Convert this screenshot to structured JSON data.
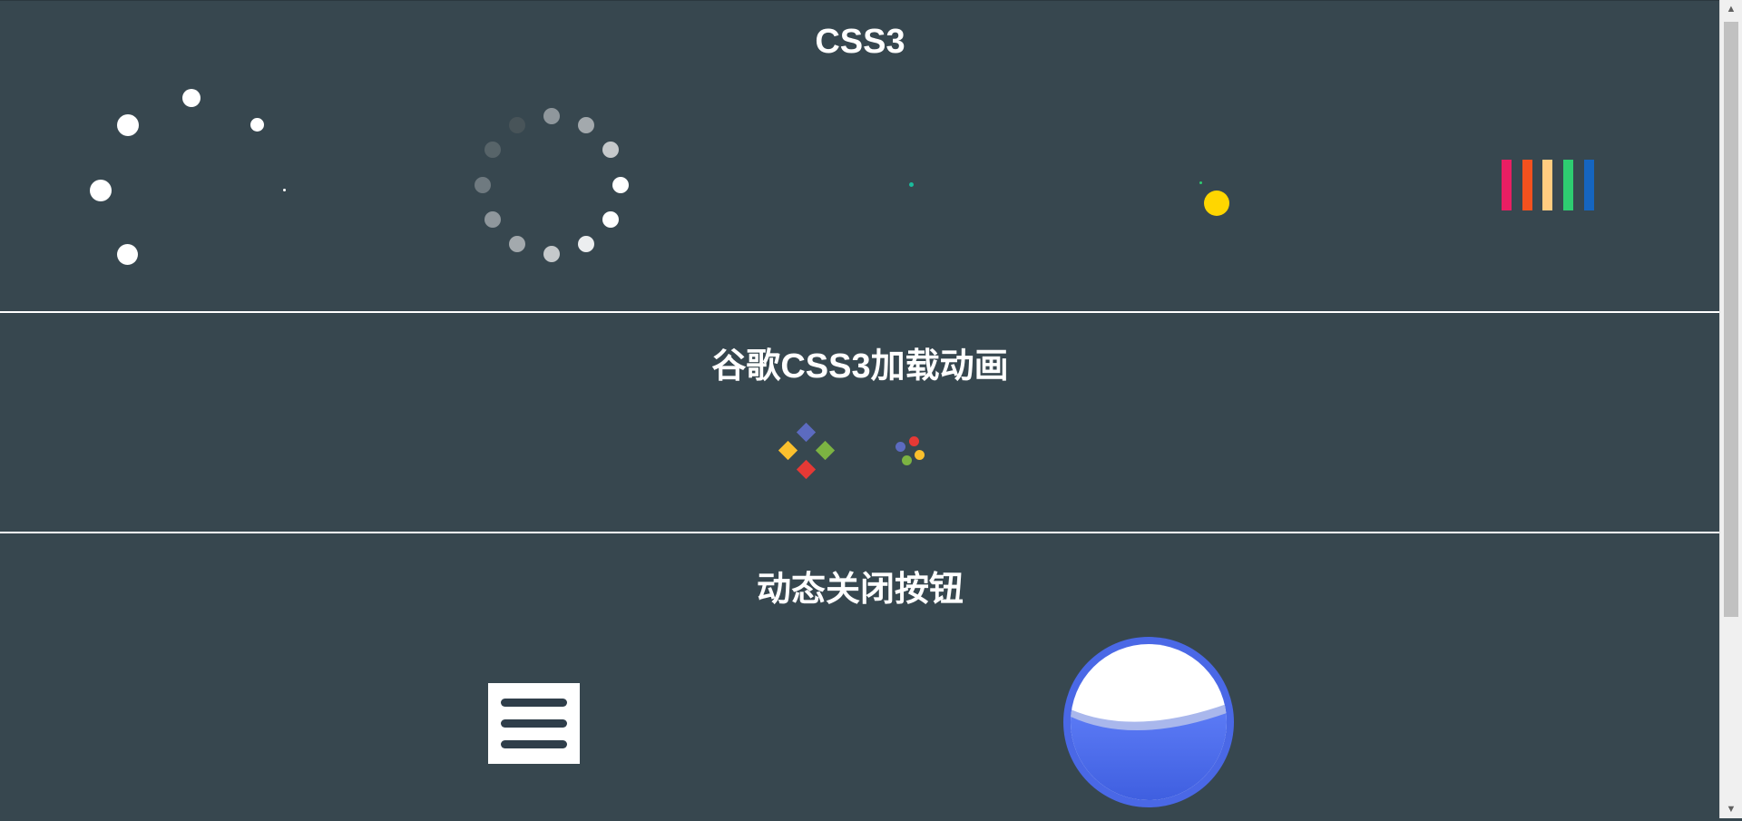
{
  "sections": {
    "css3": {
      "title": "CSS3"
    },
    "google": {
      "title": "谷歌CSS3加载动画"
    },
    "close": {
      "title": "动态关闭按钮"
    }
  },
  "colors": {
    "background": "#37474f",
    "divider": "#ffffff",
    "bars": [
      "#e91e63",
      "#f4511e",
      "#ffcc80",
      "#2ecc71",
      "#1565c0"
    ],
    "google_diamonds": [
      "#5c6bc0",
      "#fbc02d",
      "#7cb342",
      "#e53935"
    ],
    "google_dots": [
      "#e53935",
      "#5c6bc0",
      "#fbc02d",
      "#7cb342"
    ],
    "orbit_sun": "#ffd600",
    "orbit_planet": "#2ecc71",
    "teal_dot": "#1abc9c",
    "water_blue": "#4a68e6"
  },
  "icons": {
    "menu": "hamburger-icon",
    "water": "water-ball-icon"
  }
}
